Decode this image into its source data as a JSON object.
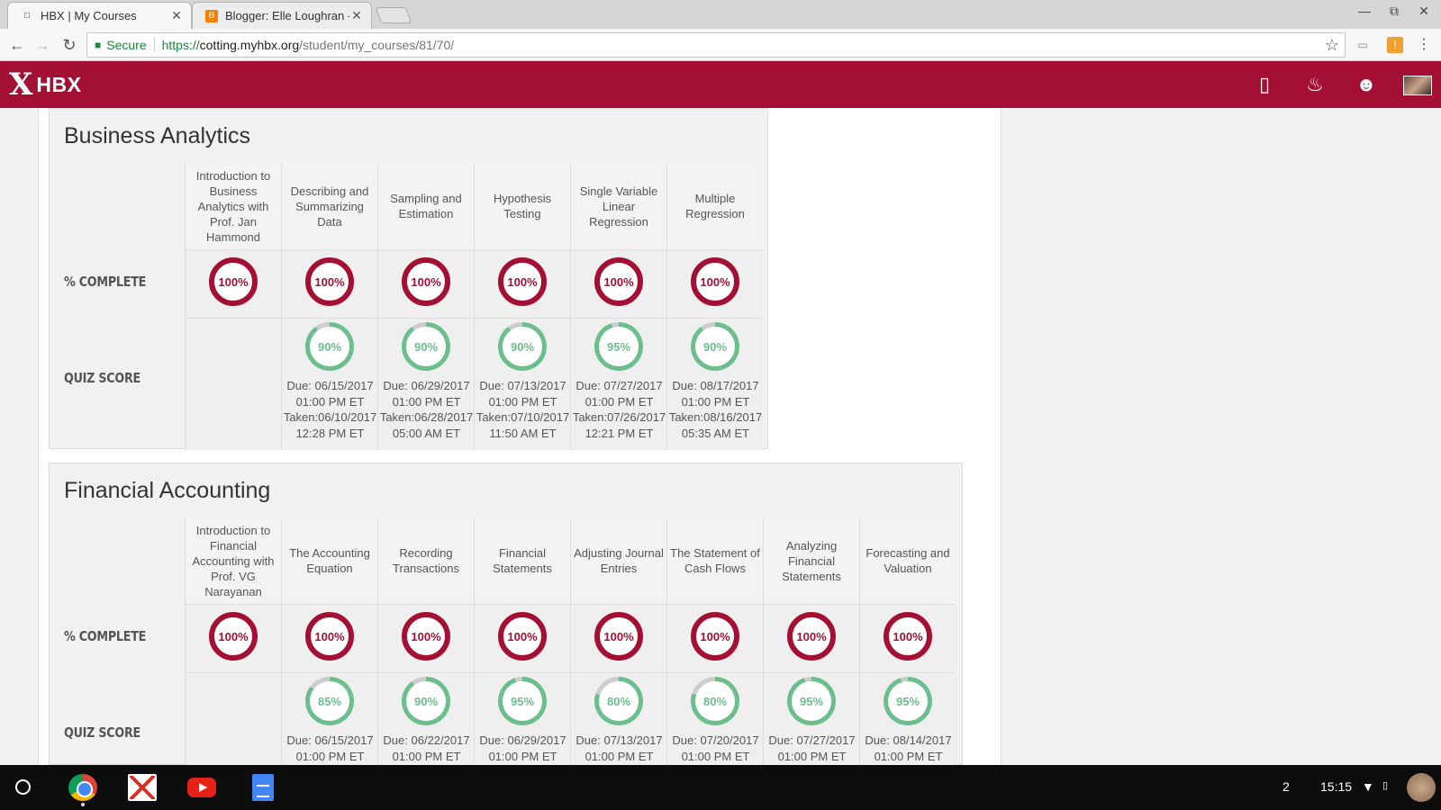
{
  "browser": {
    "tabs": [
      {
        "title": "HBX | My Courses",
        "active": true,
        "icon": "page-icon"
      },
      {
        "title": "Blogger: Elle Loughran - I",
        "active": false,
        "icon": "blogger-icon"
      }
    ],
    "address": {
      "secure_label": "Secure",
      "scheme": "https://",
      "host": "cotting.myhbx.org",
      "path": "/student/my_courses/81/70/"
    }
  },
  "header": {
    "logo_mark": "X",
    "logo_text": "HBX",
    "brand_color": "#a41034",
    "icons": [
      "notes-icon",
      "bell-icon",
      "smiley-icon",
      "profile-avatar"
    ]
  },
  "colors": {
    "complete": "#a41034",
    "quiz": "#6cbf8c",
    "quiz_track": "#cccccc"
  },
  "courses": [
    {
      "title": "Business Analytics",
      "row_labels": {
        "complete": "% COMPLETE",
        "quiz": "QUIZ SCORE"
      },
      "modules": [
        {
          "name": "Introduction to Business Analytics with Prof. Jan Hammond",
          "complete": "100%",
          "quiz": null
        },
        {
          "name": "Describing and Summarizing Data",
          "complete": "100%",
          "quiz": "90%",
          "quiz_value": 90,
          "due": "Due: 06/15/2017",
          "due_time": "01:00 PM ET",
          "taken": "Taken:06/10/2017",
          "taken_time": "12:28 PM ET"
        },
        {
          "name": "Sampling and Estimation",
          "complete": "100%",
          "quiz": "90%",
          "quiz_value": 90,
          "due": "Due: 06/29/2017",
          "due_time": "01:00 PM ET",
          "taken": "Taken:06/28/2017",
          "taken_time": "05:00 AM ET"
        },
        {
          "name": "Hypothesis Testing",
          "complete": "100%",
          "quiz": "90%",
          "quiz_value": 90,
          "due": "Due: 07/13/2017",
          "due_time": "01:00 PM ET",
          "taken": "Taken:07/10/2017",
          "taken_time": "11:50 AM ET"
        },
        {
          "name": "Single Variable Linear Regression",
          "complete": "100%",
          "quiz": "95%",
          "quiz_value": 95,
          "due": "Due: 07/27/2017",
          "due_time": "01:00 PM ET",
          "taken": "Taken:07/26/2017",
          "taken_time": "12:21 PM ET"
        },
        {
          "name": "Multiple Regression",
          "complete": "100%",
          "quiz": "90%",
          "quiz_value": 90,
          "due": "Due: 08/17/2017",
          "due_time": "01:00 PM ET",
          "taken": "Taken:08/16/2017",
          "taken_time": "05:35 AM ET"
        }
      ]
    },
    {
      "title": "Financial Accounting",
      "row_labels": {
        "complete": "% COMPLETE",
        "quiz": "QUIZ SCORE"
      },
      "modules": [
        {
          "name": "Introduction to Financial Accounting with Prof. VG Narayanan",
          "complete": "100%",
          "quiz": null
        },
        {
          "name": "The Accounting Equation",
          "complete": "100%",
          "quiz": "85%",
          "quiz_value": 85,
          "due": "Due: 06/15/2017",
          "due_time": "01:00 PM ET"
        },
        {
          "name": "Recording Transactions",
          "complete": "100%",
          "quiz": "90%",
          "quiz_value": 90,
          "due": "Due: 06/22/2017",
          "due_time": "01:00 PM ET"
        },
        {
          "name": "Financial Statements",
          "complete": "100%",
          "quiz": "95%",
          "quiz_value": 95,
          "due": "Due: 06/29/2017",
          "due_time": "01:00 PM ET"
        },
        {
          "name": "Adjusting Journal Entries",
          "complete": "100%",
          "quiz": "80%",
          "quiz_value": 80,
          "due": "Due: 07/13/2017",
          "due_time": "01:00 PM ET"
        },
        {
          "name": "The Statement of Cash Flows",
          "complete": "100%",
          "quiz": "80%",
          "quiz_value": 80,
          "due": "Due: 07/20/2017",
          "due_time": "01:00 PM ET"
        },
        {
          "name": "Analyzing Financial Statements",
          "complete": "100%",
          "quiz": "95%",
          "quiz_value": 95,
          "due": "Due: 07/27/2017",
          "due_time": "01:00 PM ET"
        },
        {
          "name": "Forecasting and Valuation",
          "complete": "100%",
          "quiz": "95%",
          "quiz_value": 95,
          "due": "Due: 08/14/2017",
          "due_time": "01:00 PM ET"
        }
      ]
    }
  ],
  "shelf": {
    "apps": [
      "chrome-icon",
      "gmail-icon",
      "youtube-icon",
      "docs-icon"
    ],
    "notification_count": "2",
    "time": "15:15"
  }
}
